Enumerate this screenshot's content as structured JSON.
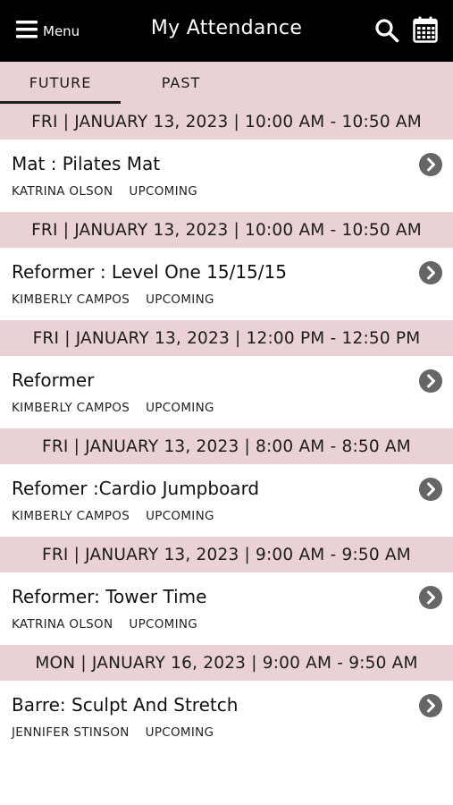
{
  "header": {
    "menu_label": "Menu",
    "title": "My Attendance"
  },
  "tabs": [
    {
      "label": "FUTURE",
      "active": true
    },
    {
      "label": "PAST",
      "active": false
    }
  ],
  "groups": [
    {
      "date_time": "FRI | JANUARY 13, 2023 | 10:00 AM - 10:50 AM",
      "class_name": "Mat : Pilates Mat",
      "instructor": "KATRINA OLSON",
      "status": "UPCOMING"
    },
    {
      "date_time": "FRI | JANUARY 13, 2023 | 10:00 AM - 10:50 AM",
      "class_name": "Reformer : Level One 15/15/15",
      "instructor": "KIMBERLY CAMPOS",
      "status": "UPCOMING"
    },
    {
      "date_time": "FRI | JANUARY 13, 2023 | 12:00 PM - 12:50 PM",
      "class_name": "Reformer",
      "instructor": "KIMBERLY CAMPOS",
      "status": "UPCOMING"
    },
    {
      "date_time": "FRI | JANUARY 13, 2023 | 8:00 AM - 8:50 AM",
      "class_name": "Refomer :Cardio Jumpboard",
      "instructor": "KIMBERLY CAMPOS",
      "status": "UPCOMING"
    },
    {
      "date_time": "FRI | JANUARY 13, 2023 | 9:00 AM - 9:50 AM",
      "class_name": "Reformer: Tower Time",
      "instructor": "KATRINA OLSON",
      "status": "UPCOMING"
    },
    {
      "date_time": "MON | JANUARY 16, 2023 | 9:00 AM - 9:50 AM",
      "class_name": "Barre: Sculpt And Stretch",
      "instructor": "JENNIFER STINSON",
      "status": "UPCOMING"
    }
  ],
  "icons": {
    "menu": "hamburger-icon",
    "search": "search-icon",
    "calendar": "calendar-icon",
    "row_action": "chevron-right-circle-icon"
  },
  "colors": {
    "header_bg": "#000000",
    "section_bg": "#ead1d3",
    "chevron": "#666666"
  }
}
